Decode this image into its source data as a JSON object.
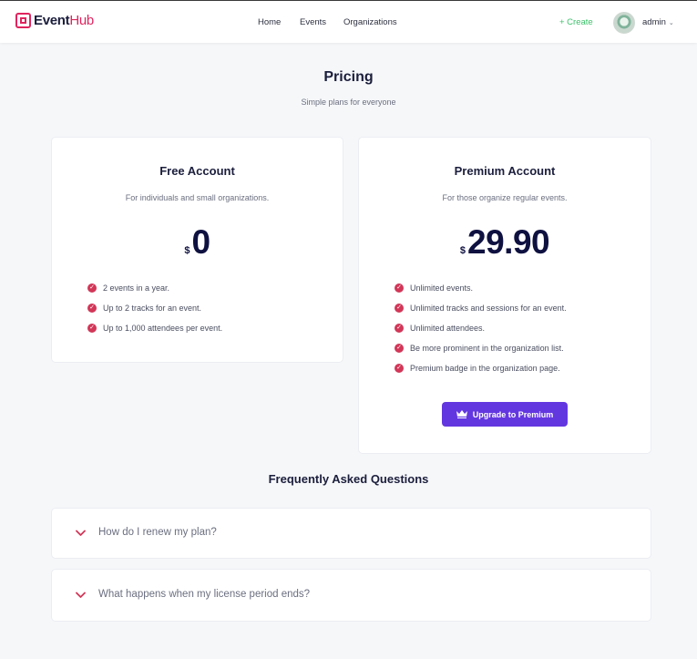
{
  "header": {
    "logo_part1": "Event",
    "logo_part2": "Hub",
    "nav": [
      "Home",
      "Events",
      "Organizations"
    ],
    "create_label": "+ Create",
    "user_name": "admin"
  },
  "page": {
    "title": "Pricing",
    "subtitle": "Simple plans for everyone"
  },
  "plans": [
    {
      "name": "Free Account",
      "description": "For individuals and small organizations.",
      "currency": "$",
      "price": "0",
      "features": [
        "2 events in a year.",
        "Up to 2 tracks for an event.",
        "Up to 1,000 attendees per event."
      ]
    },
    {
      "name": "Premium Account",
      "description": "For those organize regular events.",
      "currency": "$",
      "price": "29.90",
      "features": [
        "Unlimited events.",
        "Unlimited tracks and sessions for an event.",
        "Unlimited attendees.",
        "Be more prominent in the organization list.",
        "Premium badge in the organization page."
      ],
      "button_label": "Upgrade to Premium"
    }
  ],
  "faq": {
    "title": "Frequently Asked Questions",
    "items": [
      "How do I renew my plan?",
      "What happens when my license period ends?"
    ]
  },
  "colors": {
    "brand": "#e0245e",
    "create": "#3cc26a",
    "upgrade": "#6337e0",
    "check": "#d23758",
    "heading": "#1b1e3c"
  },
  "icons": [
    "logo-icon",
    "chevron-down-icon",
    "check-circle-icon",
    "crown-icon"
  ]
}
